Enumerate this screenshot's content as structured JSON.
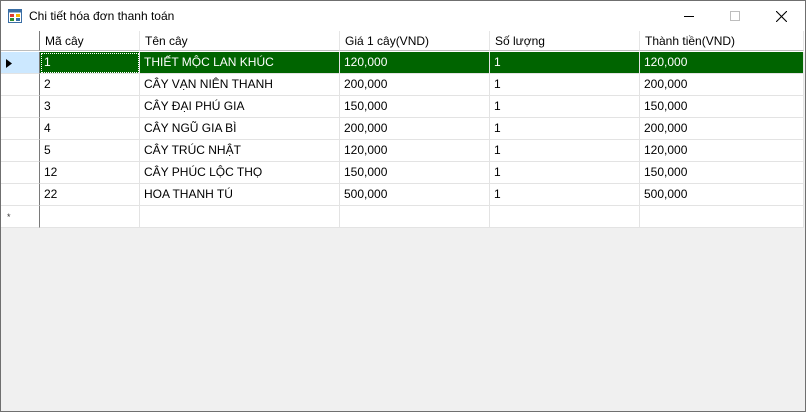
{
  "window": {
    "title": "Chi tiết hóa đơn thanh toán",
    "buttons": [
      "minimize",
      "maximize",
      "close"
    ]
  },
  "grid": {
    "columns": [
      "Mã cây",
      "Tên cây",
      "Giá 1 cây(VND)",
      "Số lượng",
      "Thành tiền(VND)"
    ],
    "rows": [
      [
        "1",
        "THIẾT MỘC LAN KHÚC",
        "120,000",
        "1",
        "120,000"
      ],
      [
        "2",
        "CÂY VẠN NIÊN THANH",
        "200,000",
        "1",
        "200,000"
      ],
      [
        "3",
        "CÂY ĐẠI PHÚ GIA",
        "150,000",
        "1",
        "150,000"
      ],
      [
        "4",
        "CÂY NGŨ GIA BÌ",
        "200,000",
        "1",
        "200,000"
      ],
      [
        "5",
        "CÂY TRÚC NHẬT",
        "120,000",
        "1",
        "120,000"
      ],
      [
        "12",
        "CÂY PHÚC LỘC THỌ",
        "150,000",
        "1",
        "150,000"
      ],
      [
        "22",
        "HOA THANH TÚ",
        "500,000",
        "1",
        "500,000"
      ]
    ],
    "selected_row": 0,
    "new_row_marker": "*"
  },
  "colors": {
    "selection_bg": "#006400",
    "row_header_selected": "#cce8ff",
    "grid_background": "#f0f0f0"
  },
  "icons": {
    "app": "app-form-icon",
    "current_row": "row-pointer-icon",
    "new_row": "new-row-asterisk-icon"
  }
}
